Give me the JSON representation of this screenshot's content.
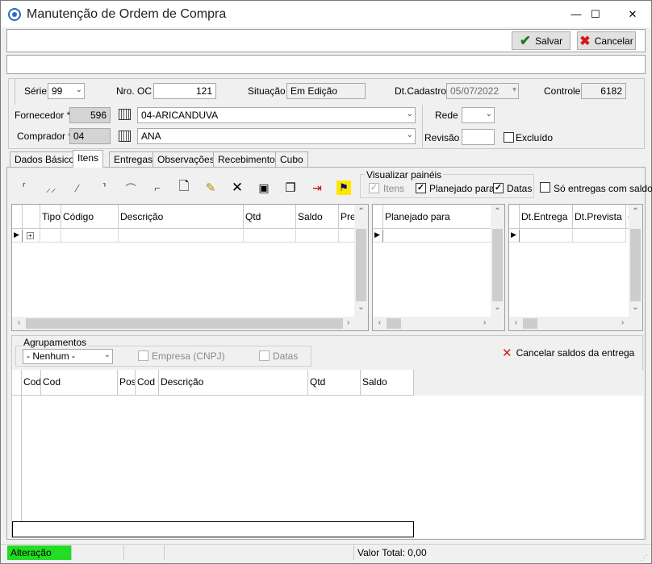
{
  "window": {
    "title": "Manutenção de Ordem de Compra",
    "minimize": "—",
    "maximize": "☐",
    "close": "✕",
    "close_color": "#c42b1c"
  },
  "toolbar": {
    "save_label": "Salvar",
    "cancel_label": "Cancelar"
  },
  "header": {
    "serie_label": "Série",
    "serie_value": "99",
    "nro_oc_label": "Nro. OC",
    "nro_oc_value": "121",
    "situacao_label": "Situação",
    "situacao_value": "Em Edição",
    "dt_cadastro_label": "Dt.Cadastro",
    "dt_cadastro_value": "05/07/2022",
    "controle_label": "Controle",
    "controle_value": "6182",
    "fornecedor_label": "Fornecedor *",
    "fornecedor_code": "596",
    "fornecedor_name": "04-ARICANDUVA",
    "comprador_label": "Comprador *",
    "comprador_code": "04",
    "comprador_name": "ANA",
    "rede_label": "Rede",
    "rede_value": "",
    "revisao_label": "Revisão",
    "revisao_value": "",
    "excluido_label": "Excluído"
  },
  "tabs": [
    {
      "label": "Dados Básicos"
    },
    {
      "label": "Itens"
    },
    {
      "label": "Entregas"
    },
    {
      "label": "Observações"
    },
    {
      "label": "Recebimentos"
    },
    {
      "label": "Cubo"
    }
  ],
  "active_tab": "Itens",
  "panels": {
    "group_label": "Visualizar painéis",
    "itens_label": "Itens",
    "itens_checked": true,
    "planejado_label": "Planejado para",
    "planejado_checked": true,
    "datas_label": "Datas",
    "datas_checked": true,
    "so_entregas_label": "Só entregas com saldo",
    "so_entregas_checked": false
  },
  "items_grid": {
    "columns": [
      "Tipo",
      "Código",
      "Descrição",
      "Qtd",
      "Saldo",
      "Preç"
    ]
  },
  "planned_grid": {
    "columns": [
      "Planejado para"
    ]
  },
  "dates_grid": {
    "columns": [
      "Dt.Entrega",
      "Dt.Prevista",
      "("
    ]
  },
  "grouping": {
    "label": "Agrupamentos",
    "select_value": "- Nenhum -",
    "empresa_label": "Empresa (CNPJ)",
    "datas_label": "Datas"
  },
  "cancel_saldos_label": "Cancelar saldos da entrega",
  "bottom_grid": {
    "columns": [
      "Cod",
      "Cod",
      "Pos",
      "Cod",
      "Descrição",
      "Qtd",
      "Saldo"
    ]
  },
  "statusbar": {
    "mode": "Alteração",
    "mode_color": "#22dd22",
    "total_label": "Valor Total: 0,00"
  },
  "colors": {
    "accent_check": "#1e7d1e",
    "cancel_x": "#d01c1c"
  }
}
